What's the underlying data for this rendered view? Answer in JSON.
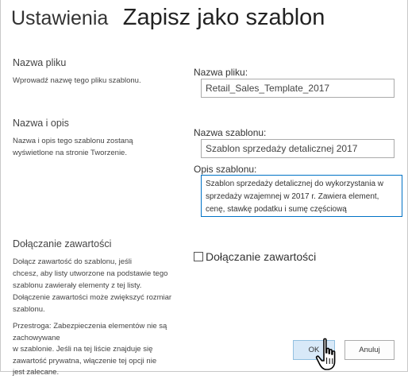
{
  "header": {
    "breadcrumb": "Ustawienia",
    "title": "Zapisz jako szablon"
  },
  "file_section": {
    "heading": "Nazwa pliku",
    "description": "Wprowadź nazwę tego pliku szablonu.",
    "field_label": "Nazwa pliku:",
    "field_value": "Retail_Sales_Template_2017"
  },
  "name_section": {
    "heading": "Nazwa i opis",
    "description_line1": "Nazwa i opis tego szablonu zostaną",
    "description_line2": "wyświetlone na stronie Tworzenie.",
    "name_label": "Nazwa szablonu:",
    "name_value": "Szablon sprzedaży detalicznej 2017",
    "desc_label": "Opis szablonu:",
    "desc_value": "Szablon sprzedaży detalicznej do wykorzystania w sprzedaży wzajemnej w 2017 r. Zawiera element, cenę, stawkę podatku i sumę częściową"
  },
  "content_section": {
    "heading": "Dołączanie zawartości",
    "description_lines": [
      "Dołącz zawartość do szablonu, jeśli",
      "chcesz, aby listy utworzone na podstawie tego",
      "szablonu zawierały elementy z tej listy.",
      "Dołączenie zawartości może zwiększyć rozmiar",
      "szablonu."
    ],
    "checkbox_label": "Dołączanie zawartości",
    "checkbox_checked": false,
    "warning_lines": [
      "Przestroga: Zabezpieczenia elementów nie są zachowywane",
      "w szablonie. Jeśli na tej liście znajduje się",
      "zawartość prywatna, włączenie tej opcji nie",
      "jest zalecane."
    ]
  },
  "buttons": {
    "ok_label": "OK",
    "cancel_label": "Anuluj"
  },
  "colors": {
    "accent_border": "#0072c6",
    "ok_button_bg": "#d8e9f8",
    "text": "#444444"
  },
  "icons": {
    "cursor": "hand-pointer-icon"
  }
}
